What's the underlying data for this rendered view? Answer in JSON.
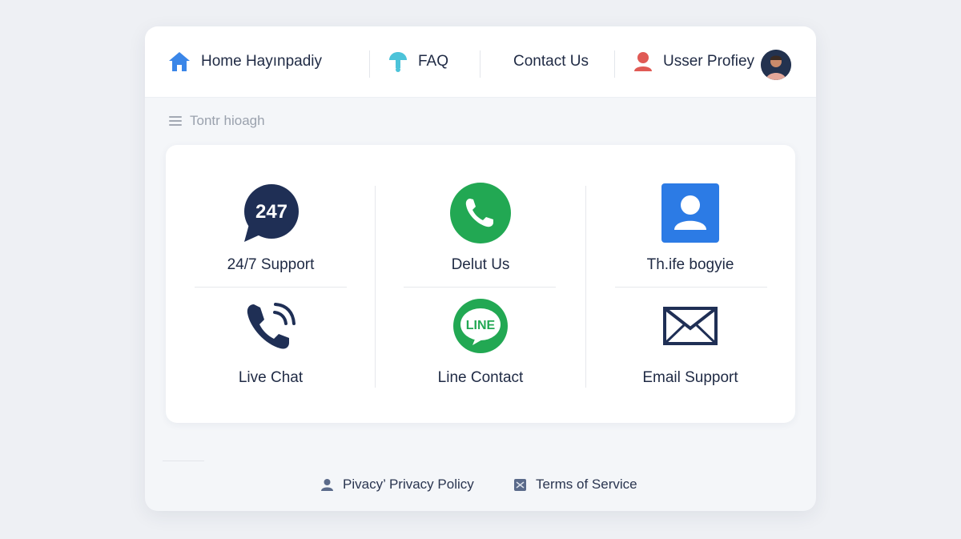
{
  "nav": {
    "home_label": "Home Hayınpadiy",
    "faq_label": "FAQ",
    "contact_label": "Contact Us",
    "profile_label": "Usser Profiey"
  },
  "breadcrumb": {
    "label": "Tontr hioagh"
  },
  "tiles": [
    {
      "label": "24/7 Support",
      "icon": "chat-bubble-247-icon",
      "badge": "247"
    },
    {
      "label": "Delut Us",
      "icon": "phone-circle-icon"
    },
    {
      "label": "Th.ife bogyie",
      "icon": "user-square-icon"
    },
    {
      "label": "Live Chat",
      "icon": "phone-ringing-icon"
    },
    {
      "label": "Line Contact",
      "icon": "line-app-icon",
      "badge": "LINE"
    },
    {
      "label": "Email Support",
      "icon": "envelope-icon"
    }
  ],
  "footer": {
    "privacy_label": "Pivаcy’ Privacy Policy",
    "terms_label": "Terms of Service"
  },
  "colors": {
    "home_icon": "#3a86e8",
    "faq_icon": "#4cc3d9",
    "profile_icon": "#e05a55",
    "navy": "#1f2a44",
    "green": "#22a853",
    "blue": "#2c7be5"
  }
}
